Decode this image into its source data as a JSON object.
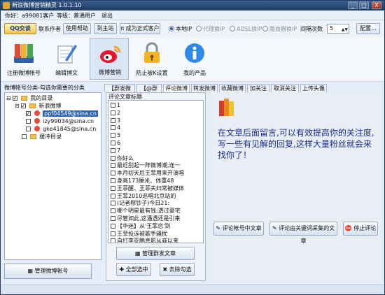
{
  "window": {
    "title": "新浪微博营销精灵 1.0.1.10",
    "minimize": "_",
    "maximize": "□",
    "close": "X"
  },
  "info": {
    "user": "你好：a99081客户",
    "level": "等级：普通用户",
    "logout": "退出"
  },
  "toolbar": {
    "qq": "QQ交谈",
    "contact": "联系作者",
    "help": "使用帮助",
    "site": "到主站",
    "upgrade": "π 成为正式客户",
    "radio_local": "本地IP",
    "radio_proxy": "代理换IP",
    "radio_adsl": "ADSL换IP",
    "radio_router": "路由器换IP",
    "interval_label": "间隔次数",
    "interval_value": "5",
    "config": "配置..."
  },
  "iconbar": {
    "register": "注册微博帐号",
    "edit": "编辑博文",
    "marketing": "微博营销",
    "security": "防止被K设置",
    "products": "我的产品"
  },
  "left": {
    "title": "微博帐号分类-勾选你需要的分类",
    "root": "我的目录",
    "group_sina": "新浪微博",
    "acct1": "ppf04549@sina.cn",
    "acct2": "izy99034@sina.cn",
    "acct3": "gke41845@sina.cn",
    "group_wait": "缓冲目录",
    "manage": "管理微博帐号"
  },
  "tabs": [
    "【群发微博】",
    "【@群发】",
    "评论微博",
    "转发微博",
    "收藏微博",
    "加关注",
    "取消关注",
    "上传头像"
  ],
  "mid": {
    "title": "评论文章标题",
    "items": [
      "1",
      "2",
      "3",
      "4",
      "5",
      "6",
      "7",
      "你好么",
      "最近刮起一阵微博潮,连一",
      "本月初天后王菲用来开演唱",
      "身高173厘米、体重48",
      "王菲醒、王菲夫妇常被媒体",
      "王菲2010巡唱北京站的",
      "(记者穆钞子)今日21:",
      "哪个明星最有钱;透过豪宅",
      "尽管如此,这潘透还是引来",
      "【华迷】从'王菲恋'到",
      "王菲投诉被歌手骚扰",
      "自打李亚鹏息影从商以来"
    ],
    "manage": "管理群发文章",
    "select_all": "全部选中",
    "clear": "去除勾选"
  },
  "right": {
    "text": "在文章后面留言,可以有效提高你的关注度,写一些有见解的回复,这样大量粉丝就会来找你了！",
    "btn_comment": "评论帐号中文章",
    "btn_keyword": "评论由关键词采集的文章",
    "btn_stop": "停止评论"
  },
  "colors": {
    "accent": "#2c62b8",
    "text_blue": "#1a2e8c"
  }
}
